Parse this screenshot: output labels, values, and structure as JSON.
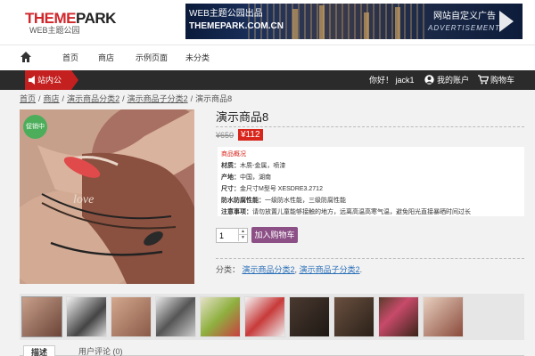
{
  "header": {
    "logo_main_red": "THEME",
    "logo_main_dark": "PARK",
    "logo_sub": "WEB主题公园",
    "banner": {
      "line1": "WEB主题公园出品",
      "line2": "THEMEPARK.COM.CN",
      "line3": "网站自定义广告",
      "line4": "ADVERTISEMENT"
    }
  },
  "nav": {
    "items": [
      "首页",
      "商店",
      "示例页面",
      "未分类"
    ]
  },
  "topbar": {
    "notice_label": "站内公告:",
    "greeting": "你好！ jack1",
    "account": "我的账户",
    "cart": "购物车"
  },
  "breadcrumb": {
    "items": [
      "首页",
      "商店",
      "演示商品分类2",
      "演示商品子分类2",
      "演示商品8"
    ],
    "separator": "/"
  },
  "product": {
    "badge": "促销中",
    "title": "演示商品8",
    "old_price": "¥650",
    "new_price": "¥112",
    "specs_heading": "商品概况",
    "specs": [
      {
        "key": "材质：",
        "value": "木质-金属，喷漆"
      },
      {
        "key": "产地：",
        "value": "中国，湖南"
      },
      {
        "key": "尺寸：",
        "value": "金尺寸M型号 XESDRE3.2712"
      },
      {
        "key": "防水防腐性能：",
        "value": "一级防水性能，三级防腐性能"
      },
      {
        "key": "注意事项：",
        "value": "请勿放置儿童能够接触的地方，远离高温高寒气温，避免阳光直接暴晒时间过长"
      }
    ],
    "quantity": "1",
    "add_to_cart": "加入购物车",
    "categories_label": "分类：",
    "categories": [
      "演示商品分类2",
      "演示商品子分类2"
    ],
    "categories_suffix": "."
  },
  "tabs": [
    "描述",
    "用户评论 (0)"
  ],
  "colors": {
    "brand_red": "#d1262a",
    "price_red": "#d9261c",
    "sale_green": "#4cae5a",
    "add_cart_purple": "#8c4f86",
    "link_blue": "#2a6fb8",
    "topbar_dark": "#2b2b2b"
  },
  "icons": {
    "nav_home": "home-icon",
    "notice": "speaker-icon",
    "account": "user-icon",
    "cart": "cart-icon"
  }
}
